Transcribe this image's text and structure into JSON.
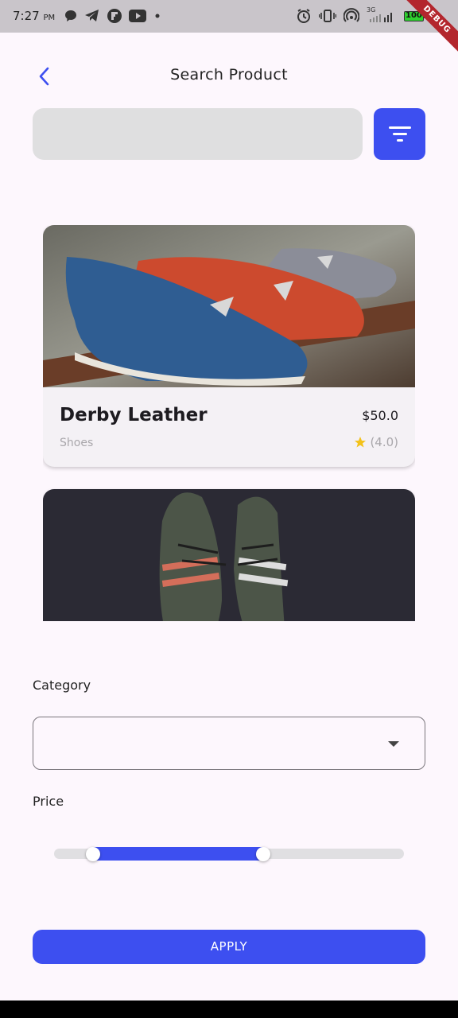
{
  "status_bar": {
    "time": "7:27",
    "ampm": "PM",
    "left_icons": [
      "chat-bubble-icon",
      "telegram-icon",
      "flipboard-icon",
      "youtube-icon",
      "dot-icon"
    ],
    "right_icons": [
      "alarm-icon",
      "vibrate-icon",
      "hotspot-icon",
      "signal-icon",
      "battery-icon"
    ],
    "network": "3G",
    "battery": "100",
    "debug_banner": "DEBUG"
  },
  "app_bar": {
    "title": "Search Product",
    "back_icon": "chevron-left-icon"
  },
  "search": {
    "placeholder": "",
    "filter_icon": "filter-icon"
  },
  "products": [
    {
      "name": "Derby Leather",
      "price": "$50.0",
      "category": "Shoes",
      "rating": "(4.0)",
      "image": "blue-red-grey-loafers-photo"
    },
    {
      "image": "grey-sneakers-photo"
    }
  ],
  "filters": {
    "category_label": "Category",
    "category_value": "",
    "price_label": "Price",
    "price_range": {
      "min_fraction": 0.11,
      "max_fraction": 0.6
    }
  },
  "apply_label": "APPLY",
  "colors": {
    "accent": "#3d4ff0",
    "background": "#fdf7fd",
    "search_field": "#dfdfe0",
    "card": "#f4f1f5"
  }
}
